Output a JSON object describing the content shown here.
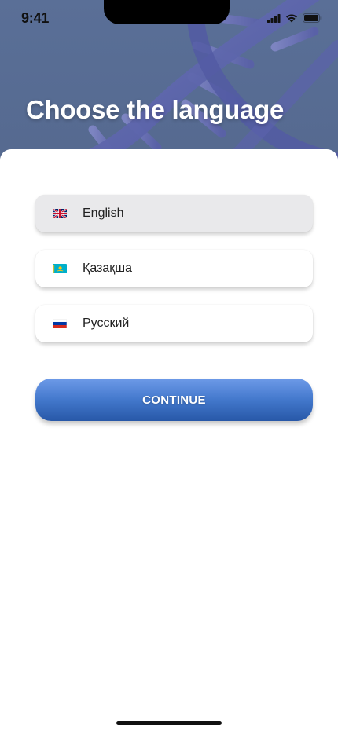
{
  "status_bar": {
    "time": "9:41",
    "icons": [
      "cellular-signal-icon",
      "wifi-icon",
      "battery-icon"
    ]
  },
  "header": {
    "title": "Choose the language"
  },
  "languages": [
    {
      "label": "English",
      "flag": "uk-flag-icon",
      "selected": true
    },
    {
      "label": "Қазақша",
      "flag": "kazakhstan-flag-icon",
      "selected": false
    },
    {
      "label": "Русский",
      "flag": "russia-flag-icon",
      "selected": false
    }
  ],
  "actions": {
    "continue_label": "CONTINUE"
  },
  "colors": {
    "hero_background": "#576c93",
    "selected_option": "#e9e9eb",
    "button_top": "#6d9ae8",
    "button_bottom": "#2858a8"
  }
}
